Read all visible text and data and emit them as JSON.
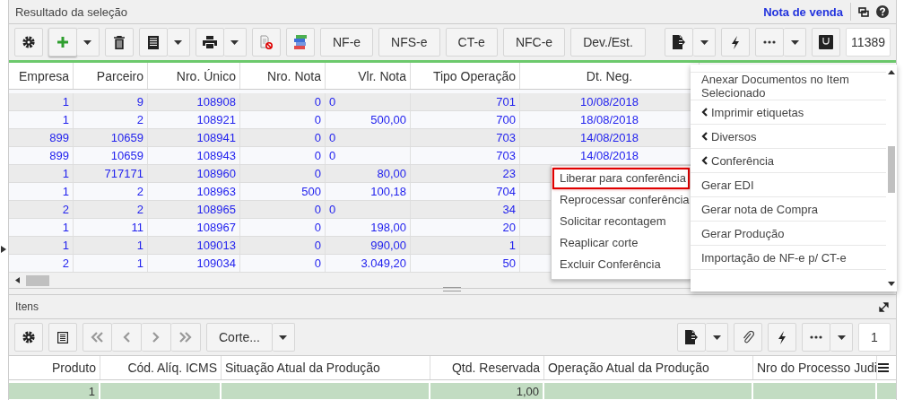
{
  "header": {
    "title": "Resultado da seleção",
    "link": "Nota de venda"
  },
  "toolbar": {
    "text_buttons": [
      "NF-e",
      "NFS-e",
      "CT-e",
      "NFC-e",
      "Dev./Est."
    ],
    "record_field": "11389"
  },
  "grid": {
    "columns": [
      "Empresa",
      "Parceiro",
      "Nro. Único",
      "Nro. Nota",
      "Vlr. Nota",
      "Tipo Operação",
      "Dt. Neg."
    ],
    "rows": [
      {
        "cells": [
          "1",
          "9",
          "108908",
          "0",
          "0",
          "701",
          "10/08/2018"
        ],
        "kind": "raw"
      },
      {
        "cells": [
          "1",
          "2",
          "108921",
          "0",
          "500,00",
          "700",
          "18/08/2018"
        ],
        "kind": "money"
      },
      {
        "cells": [
          "899",
          "10659",
          "108941",
          "0",
          "0",
          "703",
          "14/08/2018"
        ],
        "kind": "raw"
      },
      {
        "cells": [
          "899",
          "10659",
          "108943",
          "0",
          "0",
          "703",
          "14/08/2018"
        ],
        "kind": "raw"
      },
      {
        "cells": [
          "1",
          "717171",
          "108960",
          "0",
          "80,00",
          "23"
        ],
        "kind": "money"
      },
      {
        "cells": [
          "1",
          "2",
          "108963",
          "500",
          "100,18",
          "704"
        ],
        "kind": "money"
      },
      {
        "cells": [
          "2",
          "2",
          "108965",
          "0",
          "0",
          "34"
        ],
        "kind": "raw"
      },
      {
        "cells": [
          "1",
          "11",
          "108967",
          "0",
          "198,00",
          "20"
        ],
        "kind": "money"
      },
      {
        "cells": [
          "1",
          "1",
          "109013",
          "0",
          "990,00",
          "1"
        ],
        "kind": "money"
      },
      {
        "cells": [
          "2",
          "1",
          "109034",
          "0",
          "3.049,20",
          "50"
        ],
        "kind": "money"
      }
    ]
  },
  "actions_menu": {
    "items": [
      {
        "label": "Anexar Documentos no Item Selecionado",
        "submenu": false
      },
      {
        "label": "Imprimir etiquetas",
        "submenu": true
      },
      {
        "label": "Diversos",
        "submenu": true
      },
      {
        "label": "Conferência",
        "submenu": true
      },
      {
        "label": "Gerar EDI",
        "submenu": false
      },
      {
        "label": "Gerar nota de Compra",
        "submenu": false
      },
      {
        "label": "Gerar Produção",
        "submenu": false
      },
      {
        "label": "Importação de NF-e p/ CT-e",
        "submenu": false
      }
    ]
  },
  "submenu": {
    "items": [
      {
        "label": "Liberar para conferência",
        "selected": true
      },
      {
        "label": "Reprocessar conferência",
        "selected": false
      },
      {
        "label": "Solicitar recontagem",
        "selected": false
      },
      {
        "label": "Reaplicar corte",
        "selected": false
      },
      {
        "label": "Excluir Conferência",
        "selected": false
      }
    ]
  },
  "items_panel": {
    "title": "Itens",
    "dropdown": "Corte...",
    "record_field": "1",
    "columns": [
      "Produto",
      "Cód. Alíq. ICMS",
      "Situação Atual da Produção",
      "Qtd. Reservada",
      "Operação Atual da Produção",
      "Nro do Processo Judi"
    ],
    "rows": [
      {
        "cells": [
          "1",
          null,
          null,
          "1,00",
          null,
          null
        ]
      }
    ]
  }
}
